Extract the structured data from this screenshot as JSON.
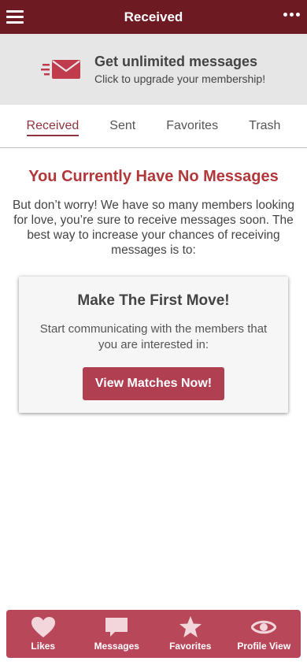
{
  "header": {
    "title": "Received",
    "menu_icon": "hamburger-menu-icon",
    "more_icon": "more-dots-icon",
    "color": "#6e1a22"
  },
  "upgrade_banner": {
    "icon": "envelope-icon",
    "heading": "Get unlimited messages",
    "subtext": "Click to upgrade your membership!"
  },
  "tabs": [
    {
      "label": "Received",
      "active": true
    },
    {
      "label": "Sent",
      "active": false
    },
    {
      "label": "Favorites",
      "active": false
    },
    {
      "label": "Trash",
      "active": false
    }
  ],
  "empty_state": {
    "title": "You Currently Have No Messages",
    "description": "But don’t worry! We have so many members looking for love, you’re sure to receive messages soon. The best way to increase your chances of receiving messages is to:"
  },
  "card": {
    "title": "Make The First Move!",
    "description": "Start communicating with the members that you are interested in:",
    "button_label": "View Matches Now!"
  },
  "bottom_nav": [
    {
      "label": "Likes",
      "icon": "heart-icon"
    },
    {
      "label": "Messages",
      "icon": "chat-bubble-icon"
    },
    {
      "label": "Favorites",
      "icon": "star-icon"
    },
    {
      "label": "Profile View",
      "icon": "eye-icon"
    }
  ],
  "colors": {
    "accent": "#b03f52",
    "title_red": "#b2373a",
    "nav_bg": "#b9475a"
  }
}
